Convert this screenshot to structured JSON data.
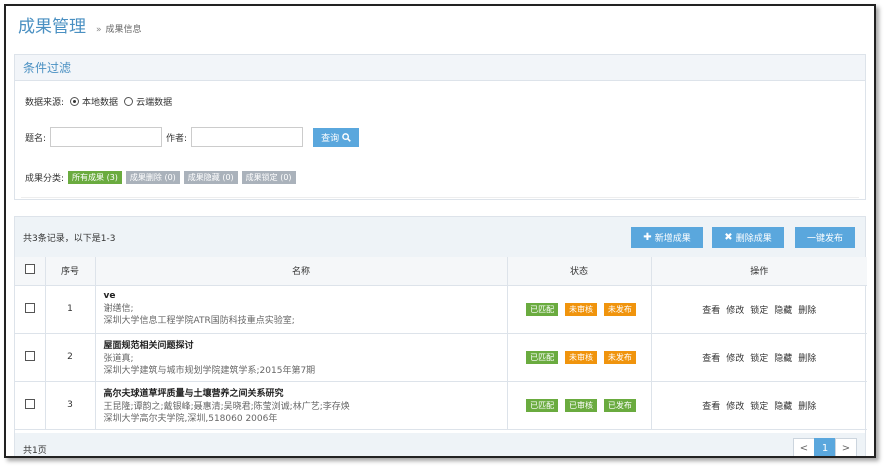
{
  "header": {
    "title": "成果管理",
    "separator": "»",
    "breadcrumb": "成果信息"
  },
  "filter": {
    "title": "条件过滤",
    "source_label": "数据来源:",
    "source_options": [
      "本地数据",
      "云端数据"
    ],
    "source_selected": "本地数据",
    "title_label": "题名:",
    "title_value": "",
    "author_label": "作者:",
    "author_value": "",
    "query_button": "查询",
    "category_label": "成果分类:",
    "categories": [
      "所有成果 (3)",
      "成果删除 (0)",
      "成果隐藏 (0)",
      "成果锁定 (0)"
    ]
  },
  "list": {
    "summary": "共3条记录，以下是1-3",
    "add_button": "新增成果",
    "delete_button": "删除成果",
    "publish_button": "一键发布",
    "columns": [
      "序号",
      "名称",
      "状态",
      "操作"
    ],
    "rows": [
      {
        "num": "1",
        "title": "ve",
        "author": "谢缮信;",
        "source": "深圳大学信息工程学院ATR国防科技重点实验室;",
        "status": [
          "已匹配",
          "未审核",
          "未发布"
        ]
      },
      {
        "num": "2",
        "title": "屋面规范相关问题探讨",
        "author": "张道真;",
        "source": "深圳大学建筑与城市规划学院建筑学系;2015年第7期",
        "status": [
          "已匹配",
          "未审核",
          "未发布"
        ]
      },
      {
        "num": "3",
        "title": "高尔夫球道草坪质量与土壤营养之间关系研究",
        "author": "王昆隆;谭韵之;戴银峰;聂惠清;吴晓君;陈莹浏诚;林广艺;李存焕",
        "source": "深圳大学高尔夫学院,深圳,518060 2006年",
        "status": [
          "已匹配",
          "已审核",
          "已发布"
        ]
      }
    ],
    "actions": [
      "查看",
      "修改",
      "锁定",
      "隐藏",
      "删除"
    ],
    "page_count": "共1页",
    "pager": {
      "prev": "<",
      "current": "1",
      "next": ">"
    }
  },
  "colors": {
    "accent": "#5aa7dd",
    "title": "#4a90c2",
    "green": "#6aab3f",
    "orange": "#f0940d",
    "gray": "#aab2bb"
  }
}
